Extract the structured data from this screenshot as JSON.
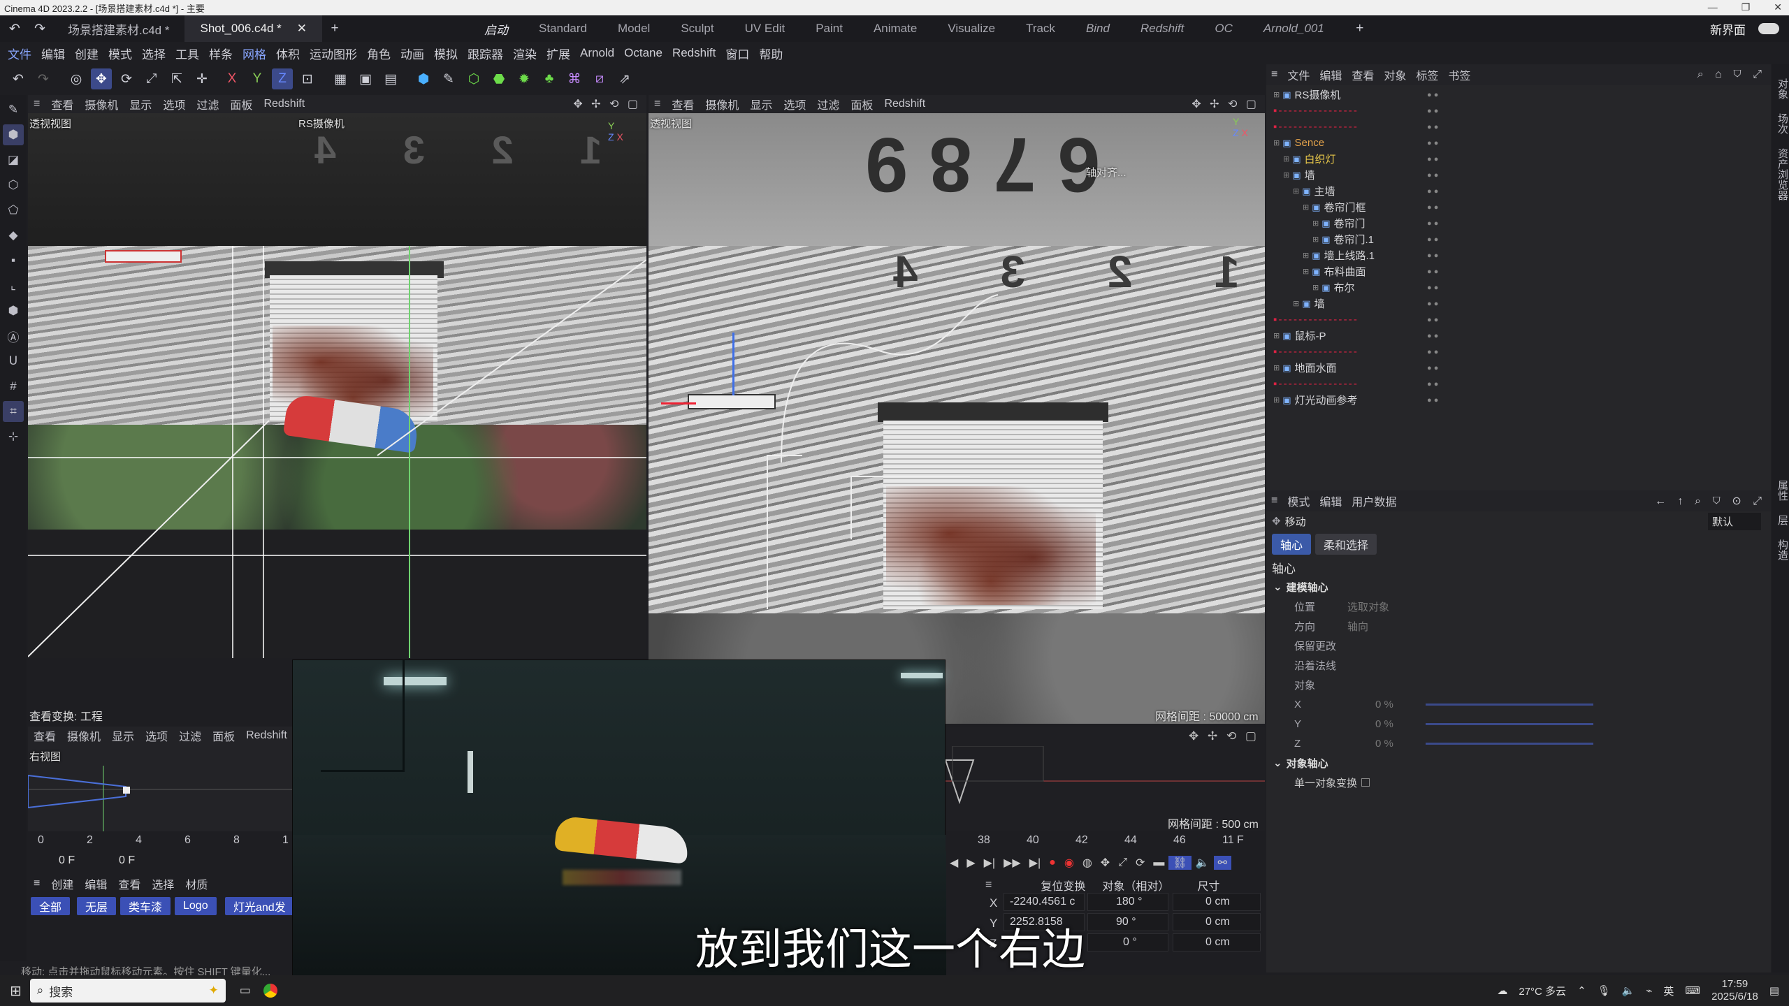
{
  "titlebar": {
    "text": "Cinema 4D 2023.2.2 - [场景搭建素材.c4d *] - 主要"
  },
  "tabs": {
    "docs": [
      "场景搭建素材.c4d *",
      "Shot_006.c4d *"
    ],
    "layouts": [
      "启动",
      "Standard",
      "Model",
      "Sculpt",
      "UV Edit",
      "Paint",
      "Animate",
      "Visualize",
      "Track",
      "Bind",
      "Redshift",
      "OC",
      "Arnold_001"
    ],
    "new_layout": "新界面"
  },
  "menu": [
    "文件",
    "编辑",
    "创建",
    "模式",
    "选择",
    "工具",
    "样条",
    "网格",
    "体积",
    "运动图形",
    "角色",
    "动画",
    "模拟",
    "跟踪器",
    "渲染",
    "扩展",
    "Arnold",
    "Octane",
    "Redshift",
    "窗口",
    "帮助"
  ],
  "viewport_menu": [
    "查看",
    "摄像机",
    "显示",
    "选项",
    "过滤",
    "面板",
    "Redshift"
  ],
  "vp_top_left": {
    "label": "透视视图",
    "camera": "RS摄像机"
  },
  "vp_top_right": {
    "label": "透视视图",
    "grid": "网格间距 : 50000 cm",
    "snap": "轴对齐..."
  },
  "vp_bottom_left": {
    "label": "右视图",
    "project": "查看变换: 工程",
    "grid": "网格间距 : 500 cm"
  },
  "timeline": {
    "ticks_left": [
      "0",
      "2",
      "4",
      "6",
      "8",
      "1"
    ],
    "ticks_right": [
      "38",
      "40",
      "42",
      "44",
      "46"
    ],
    "frame_current": "0 F",
    "frame_start": "0 F",
    "frame_end": "11 F"
  },
  "material_menu": [
    "创建",
    "编辑",
    "查看",
    "选择",
    "材质"
  ],
  "layers": [
    "全部",
    "无层",
    "类车漆",
    "Logo",
    "灯光and发"
  ],
  "coords": {
    "tabs": [
      "复位变换",
      "对象（相对）",
      "尺寸"
    ],
    "x_label": "X",
    "y_label": "Y",
    "z_label": "Z",
    "pos_x": "-2240.4561 c",
    "pos_y": "2252.8158",
    "rot_x": "180 °",
    "rot_y": "90 °",
    "rot_z": "0 °",
    "size_x": "0 cm",
    "size_y": "0 cm",
    "size_z": "0 cm"
  },
  "status": "移动: 点击并拖动鼠标移动元素。按住 SHIFT 键量化...",
  "object_manager": {
    "menu": [
      "文件",
      "编辑",
      "查看",
      "对象",
      "标签",
      "书签"
    ],
    "rows": [
      {
        "name": "RS摄像机",
        "indent": 0,
        "style": ""
      },
      {
        "name": "",
        "indent": 0,
        "style": "dash"
      },
      {
        "name": "",
        "indent": 0,
        "style": "dash"
      },
      {
        "name": "Sence",
        "indent": 0,
        "style": "orange"
      },
      {
        "name": "白织灯",
        "indent": 1,
        "style": "yellow"
      },
      {
        "name": "墙",
        "indent": 1,
        "style": ""
      },
      {
        "name": "主墙",
        "indent": 2,
        "style": ""
      },
      {
        "name": "卷帘门框",
        "indent": 3,
        "style": ""
      },
      {
        "name": "卷帘门",
        "indent": 4,
        "style": ""
      },
      {
        "name": "卷帘门.1",
        "indent": 4,
        "style": ""
      },
      {
        "name": "墙上线路.1",
        "indent": 3,
        "style": ""
      },
      {
        "name": "布料曲面",
        "indent": 3,
        "style": ""
      },
      {
        "name": "布尔",
        "indent": 4,
        "style": ""
      },
      {
        "name": "墙",
        "indent": 2,
        "style": ""
      },
      {
        "name": "",
        "indent": 0,
        "style": "dash"
      },
      {
        "name": "鼠标-P",
        "indent": 0,
        "style": ""
      },
      {
        "name": "",
        "indent": 0,
        "style": "dash"
      },
      {
        "name": "地面水面",
        "indent": 0,
        "style": ""
      },
      {
        "name": "",
        "indent": 0,
        "style": "dash"
      },
      {
        "name": "灯光动画参考",
        "indent": 0,
        "style": ""
      }
    ]
  },
  "attribute_manager": {
    "menu": [
      "模式",
      "编辑",
      "用户数据"
    ],
    "tool": "移动",
    "preset": "默认",
    "tab_axis": "轴心",
    "tab_soft": "柔和选择",
    "section": "轴心",
    "group_model": "建模轴心",
    "fields": [
      {
        "label": "位置",
        "value": "选取对象"
      },
      {
        "label": "方向",
        "value": "轴向"
      },
      {
        "label": "保留更改",
        "value": ""
      },
      {
        "label": "沿着法线",
        "value": ""
      },
      {
        "label": "对象",
        "value": ""
      }
    ],
    "pct": [
      {
        "label": "X",
        "value": "0 %"
      },
      {
        "label": "Y",
        "value": "0 %"
      },
      {
        "label": "Z",
        "value": "0 %"
      }
    ],
    "group_object": "对象轴心",
    "single": "单一对象变换"
  },
  "side_tabs": [
    "对象",
    "场次",
    "资产浏览器",
    "属性",
    "层",
    "构造"
  ],
  "subtitle": "放到我们这一个右边",
  "taskbar": {
    "search": "搜索",
    "weather": "27°C 多云",
    "ime": "英",
    "time": "17:59",
    "date": "2025/6/18"
  }
}
